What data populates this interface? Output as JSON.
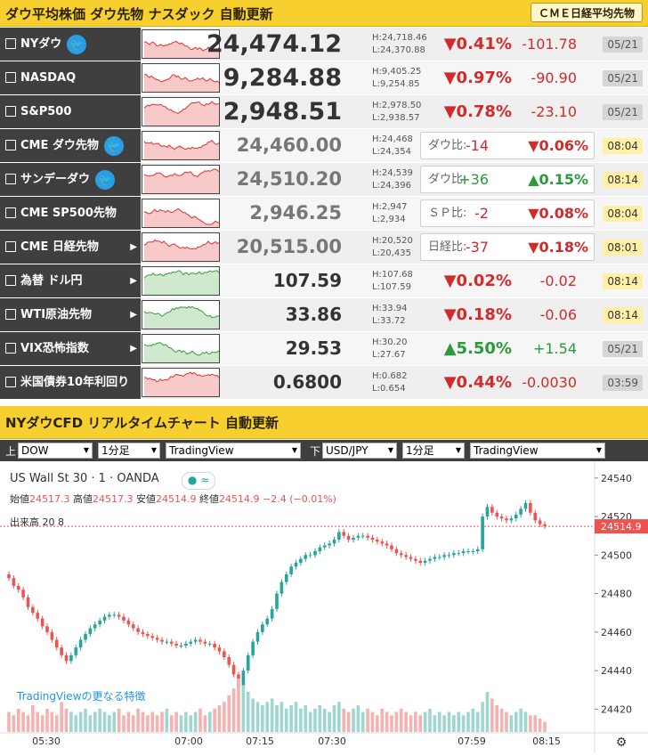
{
  "header1": {
    "title": "ダウ平均株価 ダウ先物 ナスダック 自動更新",
    "button": "ＣＭＥ日経平均先物"
  },
  "rows": [
    {
      "name": "NYダウ",
      "twitter": true,
      "price": "24,474.12",
      "high": "H:24,718.46",
      "low": "L:24,370.88",
      "change_pct": "▼0.41%",
      "change": "-101.78",
      "date": "05/21",
      "dir": "down"
    },
    {
      "name": "NASDAQ",
      "twitter": false,
      "price": "9,284.88",
      "high": "H:9,405.25",
      "low": "L:9,254.85",
      "change_pct": "▼0.97%",
      "change": "-90.90",
      "date": "05/21",
      "dir": "down"
    },
    {
      "name": "S&P500",
      "twitter": false,
      "price": "2,948.51",
      "high": "H:2,978.50",
      "low": "L:2,938.57",
      "change_pct": "▼0.78%",
      "change": "-23.10",
      "date": "05/21",
      "dir": "down"
    },
    {
      "name": "CME ダウ先物",
      "twitter": true,
      "price": "24,460.00",
      "high": "H:24,468",
      "low": "L:24,354",
      "box_label": "ダウ比:",
      "change": "-14",
      "change_pct": "▼0.06%",
      "date": "08:04",
      "dir": "down"
    },
    {
      "name": "サンデーダウ",
      "twitter": true,
      "price": "24,510.20",
      "high": "H:24,539",
      "low": "L:24,396",
      "box_label": "ダウ比:",
      "change": "+36",
      "change_pct": "▲0.15%",
      "date": "08:14",
      "dir": "up"
    },
    {
      "name": "CME SP500先物",
      "twitter": false,
      "price": "2,946.25",
      "high": "H:2,947",
      "low": "L:2,934",
      "box_label": "ＳＰ比:",
      "change": "-2",
      "change_pct": "▼0.08%",
      "date": "08:04",
      "dir": "down"
    },
    {
      "name": "CME 日経先物",
      "twitter": false,
      "arrow": true,
      "price": "20,515.00",
      "high": "H:20,520",
      "low": "L:20,435",
      "box_label": "日経比:",
      "change": "-37",
      "change_pct": "▼0.18%",
      "date": "08:01",
      "dir": "down"
    },
    {
      "name": "為替 ドル円",
      "twitter": false,
      "arrow": true,
      "price": "107.59",
      "high": "H:107.68",
      "low": "L:107.59",
      "change_pct": "▼0.02%",
      "change": "-0.02",
      "date": "08:14",
      "dir": "down"
    },
    {
      "name": "WTI原油先物",
      "twitter": false,
      "arrow": true,
      "price": "33.86",
      "high": "H:33.94",
      "low": "L:33.72",
      "change_pct": "▼0.18%",
      "change": "-0.06",
      "date": "08:14",
      "dir": "down"
    },
    {
      "name": "VIX恐怖指数",
      "twitter": false,
      "arrow": true,
      "price": "29.53",
      "high": "H:30.20",
      "low": "L:27.67",
      "change_pct": "▲5.50%",
      "change": "+1.54",
      "date": "05/21",
      "dir": "up"
    },
    {
      "name": "米国債券10年利回り",
      "twitter": false,
      "price": "0.6800",
      "high": "H:0.682",
      "low": "L:0.654",
      "change_pct": "▼0.44%",
      "change": "-0.0030",
      "date": "03:59",
      "dir": "down"
    }
  ],
  "header2": {
    "title": "NYダウCFD リアルタイムチャート 自動更新"
  },
  "selectors": {
    "upper_label": "上",
    "upper_symbol": "DOW",
    "upper_interval": "1分足",
    "upper_provider": "TradingView",
    "lower_label": "下",
    "lower_symbol": "USD/JPY",
    "lower_interval": "1分足",
    "lower_provider": "TradingView"
  },
  "chart_legend": {
    "title": "US Wall St 30 · 1 · OANDA",
    "open_label": "始値",
    "open": "24517.3",
    "high_label": "高値",
    "high": "24517.3",
    "low_label": "安値",
    "low": "24514.9",
    "close_label": "終値",
    "close": "24514.9",
    "change": "−2.4 (−0.01%)",
    "volume_label": "出来高",
    "volume": "20",
    "volume_last": "8",
    "tv_link": "TradingViewの更なる特徴",
    "last_price": "24514.9",
    "dots": "● ≈"
  },
  "colors": {
    "up": "#26a69a",
    "down": "#ef5350",
    "header": "#f7cf2e",
    "name_bg": "#3f3f3f"
  },
  "chart_data": {
    "type": "candlestick",
    "y_ticks": [
      24420,
      24440,
      24460,
      24480,
      24500,
      24520,
      24540
    ],
    "ylim": [
      24410,
      24545
    ],
    "x_ticks": [
      "05:30",
      "07:00",
      "07:15",
      "07:30",
      "07:59",
      "08:15"
    ],
    "last": 24514.9,
    "closes": [
      24488,
      24484,
      24482,
      24478,
      24473,
      24470,
      24467,
      24463,
      24460,
      24456,
      24452,
      24448,
      24445,
      24448,
      24452,
      24456,
      24459,
      24462,
      24464,
      24466,
      24468,
      24469,
      24469,
      24468,
      24466,
      24464,
      24462,
      24460,
      24459,
      24458,
      24457,
      24456,
      24455,
      24455,
      24454,
      24453,
      24453,
      24454,
      24455,
      24456,
      24455,
      24454,
      24454,
      24452,
      24450,
      24447,
      24443,
      24438,
      24432,
      24440,
      24448,
      24455,
      24460,
      24464,
      24467,
      24472,
      24480,
      24486,
      24490,
      24494,
      24496,
      24498,
      24500,
      24500,
      24502,
      24504,
      24505,
      24506,
      24508,
      24512,
      24510,
      24508,
      24509,
      24510,
      24510,
      24509,
      24508,
      24507,
      24506,
      24505,
      24503,
      24501,
      24500,
      24499,
      24498,
      24497,
      24496,
      24497,
      24498,
      24499,
      24499,
      24500,
      24500,
      24501,
      24501,
      24502,
      24502,
      24502,
      24503,
      24520,
      24525,
      24522,
      24520,
      24519,
      24518,
      24519,
      24521,
      24524,
      24527,
      24522,
      24518,
      24516,
      24515
    ],
    "volumes": [
      6,
      5,
      7,
      6,
      5,
      8,
      6,
      5,
      7,
      6,
      5,
      9,
      7,
      6,
      5,
      6,
      7,
      5,
      6,
      7,
      6,
      5,
      6,
      7,
      5,
      6,
      5,
      7,
      6,
      5,
      6,
      5,
      6,
      7,
      5,
      6,
      5,
      6,
      5,
      6,
      7,
      5,
      6,
      7,
      8,
      9,
      11,
      13,
      16,
      14,
      12,
      10,
      9,
      8,
      9,
      10,
      8,
      9,
      7,
      8,
      9,
      7,
      8,
      6,
      7,
      8,
      7,
      6,
      8,
      9,
      7,
      6,
      7,
      8,
      6,
      7,
      6,
      5,
      7,
      6,
      5,
      6,
      7,
      6,
      5,
      6,
      5,
      6,
      7,
      5,
      6,
      5,
      6,
      5,
      6,
      5,
      6,
      7,
      6,
      9,
      12,
      10,
      8,
      7,
      6,
      5,
      6,
      7,
      6,
      5,
      5,
      4,
      3
    ]
  }
}
